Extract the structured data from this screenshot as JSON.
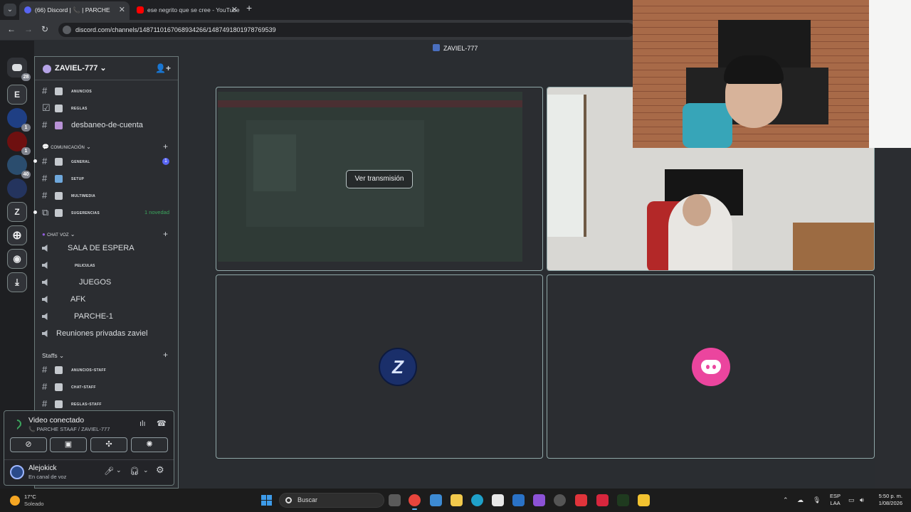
{
  "browser": {
    "tabs": [
      {
        "title": "(66) Discord | 📞 | PARCHE",
        "active": true
      },
      {
        "title": "ese negrito que se cree - YouTube",
        "active": false
      }
    ],
    "url": "discord.com/channels/1487110167068934266/1487491801978769539"
  },
  "rail": {
    "home_badge": "28",
    "servers": [
      {
        "letter": "E"
      },
      {
        "letter": "",
        "badge": "1"
      },
      {
        "letter": "",
        "badge": "1"
      },
      {
        "letter": "",
        "badge": "40"
      },
      {
        "letter": ""
      },
      {
        "letter": "Z"
      }
    ]
  },
  "server": {
    "name": "ZAVIEL-777",
    "channels_top": [
      {
        "name": "anuncios",
        "style": "sc"
      },
      {
        "name": "reglas",
        "style": "sc"
      },
      {
        "name": "desbaneo-de-cuenta",
        "style": "big"
      }
    ],
    "categories": {
      "comunicacion": "comunicación",
      "chat_voz": "chat voz",
      "staffs": "Staffs"
    },
    "channels_comunicacion": [
      {
        "name": "general",
        "badge": "1"
      },
      {
        "name": "setup"
      },
      {
        "name": "multimedia"
      },
      {
        "name": "sugerencias",
        "novedad": "1 novedad"
      }
    ],
    "voice_channels": [
      {
        "name": "SALA DE ESPERA",
        "style": "big"
      },
      {
        "name": "peliculas",
        "style": "sc"
      },
      {
        "name": "JUEGOS",
        "style": "big"
      },
      {
        "name": "AFK",
        "style": "big"
      },
      {
        "name": "PARCHE-1",
        "style": "big"
      },
      {
        "name": "Reuniones privadas zaviel",
        "style": "big"
      }
    ],
    "staff_channels": [
      {
        "name": "anuncios-staff"
      },
      {
        "name": "chat-staff"
      },
      {
        "name": "reglas-staff"
      }
    ]
  },
  "voice_panel": {
    "title": "Video conectado",
    "subtitle": "📞 PARCHE STAAF / ZAVIEL-777"
  },
  "user": {
    "name": "Alejokick",
    "status": "En canal de voz"
  },
  "stage": {
    "title": "ZAVIEL-777",
    "watch_button": "Ver transmisión"
  },
  "taskbar": {
    "temp": "17°C",
    "weather": "Soleado",
    "search": "Buscar",
    "lang1": "ESP",
    "lang2": "LAA",
    "time": "5:50 p. m.",
    "date": "1/08/2026"
  },
  "colors": {
    "accent": "#5865f2",
    "discord_pink": "#eb459e",
    "green": "#3ba55d"
  }
}
